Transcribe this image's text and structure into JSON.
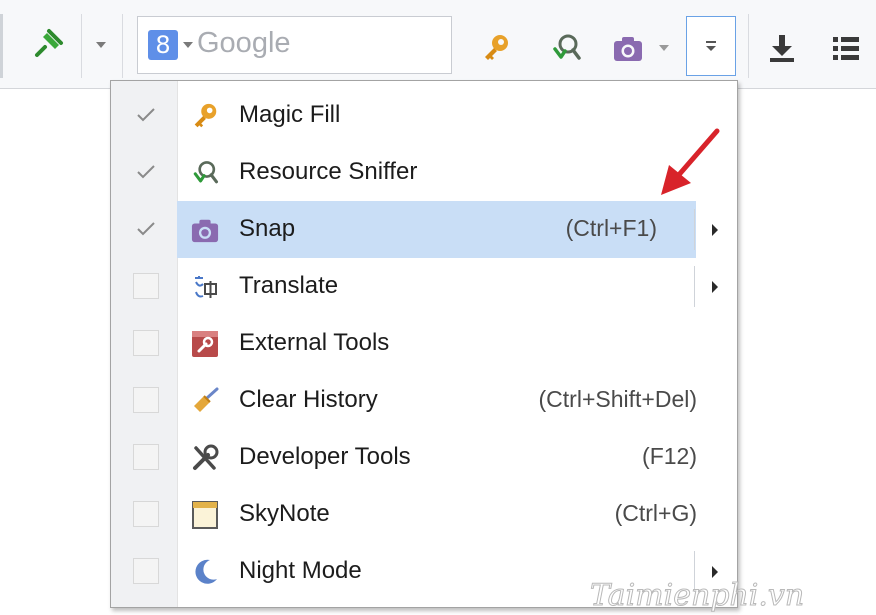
{
  "toolbar": {
    "search": {
      "engine_badge": "8",
      "placeholder": "Google"
    },
    "icons": [
      "pin-icon",
      "dropdown-arrow",
      "google-icon",
      "magic-fill-key-icon",
      "resource-sniffer-icon",
      "camera-icon",
      "menu-more-icon",
      "download-icon",
      "list-menu-icon"
    ]
  },
  "menu": {
    "items": [
      {
        "label": "Magic Fill",
        "shortcut": "",
        "checked": true,
        "highlighted": false,
        "has_submenu": false,
        "icon": "key-icon"
      },
      {
        "label": "Resource Sniffer",
        "shortcut": "",
        "checked": true,
        "highlighted": false,
        "has_submenu": false,
        "icon": "sniffer-icon"
      },
      {
        "label": "Snap",
        "shortcut": "(Ctrl+F1)",
        "checked": true,
        "highlighted": true,
        "has_submenu": true,
        "icon": "camera-icon"
      },
      {
        "label": "Translate",
        "shortcut": "",
        "checked": false,
        "highlighted": false,
        "has_submenu": true,
        "icon": "translate-icon"
      },
      {
        "label": "External Tools",
        "shortcut": "",
        "checked": false,
        "highlighted": false,
        "has_submenu": false,
        "icon": "external-tools-icon"
      },
      {
        "label": "Clear History",
        "shortcut": "(Ctrl+Shift+Del)",
        "checked": false,
        "highlighted": false,
        "has_submenu": false,
        "icon": "broom-icon"
      },
      {
        "label": "Developer Tools",
        "shortcut": "(F12)",
        "checked": false,
        "highlighted": false,
        "has_submenu": false,
        "icon": "wrench-icon"
      },
      {
        "label": "SkyNote",
        "shortcut": "(Ctrl+G)",
        "checked": false,
        "highlighted": false,
        "has_submenu": false,
        "icon": "notepad-icon"
      },
      {
        "label": "Night Mode",
        "shortcut": "",
        "checked": false,
        "highlighted": false,
        "has_submenu": true,
        "icon": "moon-icon"
      }
    ]
  },
  "watermark": "Taimienphi.vn",
  "colors": {
    "highlight": "#c9def6",
    "accent_border": "#6aa2e6",
    "arrow_red": "#d8232a"
  }
}
